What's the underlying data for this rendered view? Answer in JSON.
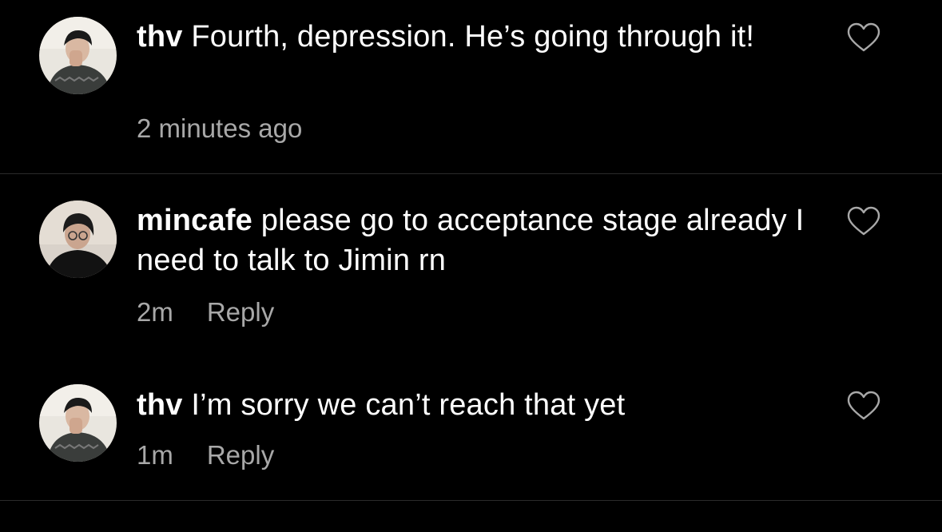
{
  "comments": [
    {
      "username": "thv",
      "text": "Fourth, depression. He’s going through it!",
      "time": "2 minutes ago",
      "reply_label": ""
    },
    {
      "username": "mincafe",
      "text": "please go to acceptance stage already I need to talk to Jimin rn",
      "time": "2m",
      "reply_label": "Reply"
    },
    {
      "username": "thv",
      "text": "I’m sorry we can’t reach that yet",
      "time": "1m",
      "reply_label": "Reply"
    }
  ],
  "icons": {
    "like": "heart-outline-icon",
    "avatar_thv": "profile-photo",
    "avatar_mincafe": "profile-photo"
  },
  "colors": {
    "background": "#000000",
    "text": "#ffffff",
    "meta": "#a8a8a8",
    "divider": "#2b2b2b"
  }
}
